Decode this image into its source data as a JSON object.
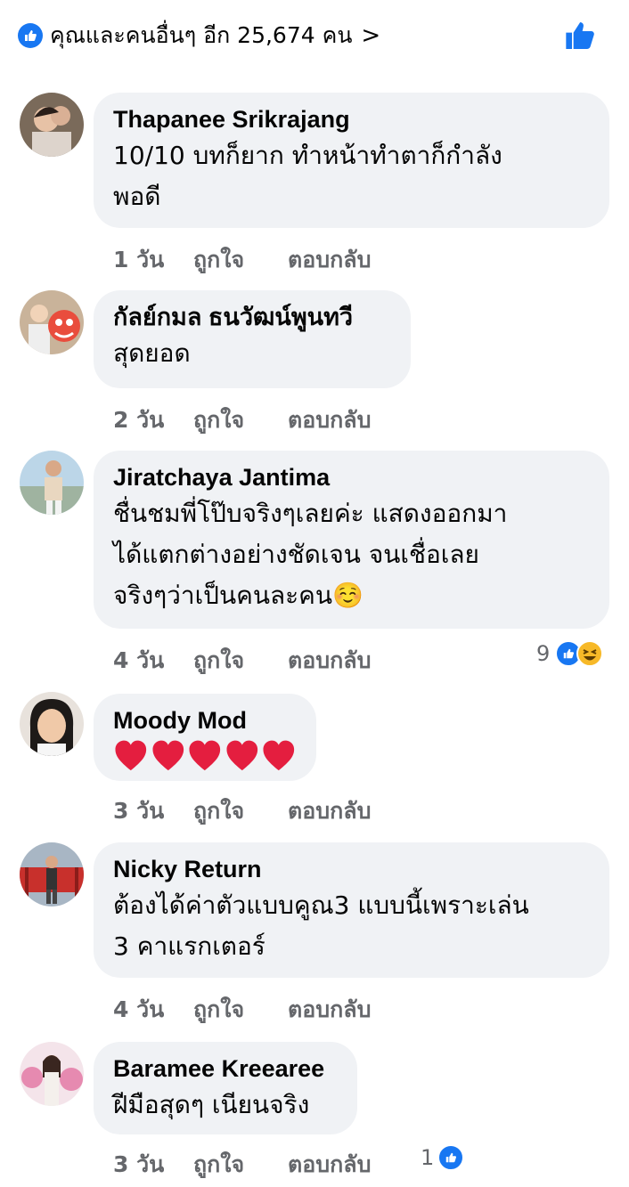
{
  "summary": {
    "text": "คุณและคนอื่นๆ อีก 25,674 คน",
    "chevron": ">"
  },
  "actions": {
    "like": "ถูกใจ",
    "reply": "ตอบกลับ"
  },
  "comments": [
    {
      "author": "Thapanee Srikrajang",
      "text_lines": [
        "10/10 บทก็ยาก ทำหน้าทำตาก็กำลัง",
        "พอดี"
      ],
      "time": "1 วัน"
    },
    {
      "author": "กัลย์กมล ธนวัฒน์พูนทวี",
      "text_lines": [
        "สุดยอด"
      ],
      "time": "2 วัน"
    },
    {
      "author": "Jiratchaya Jantima",
      "text_lines": [
        "ชื่นชมพี่โป๊บจริงๆเลยค่ะ แสดงออกมา",
        "ได้แตกต่างอย่างชัดเจน จนเชื่อเลย",
        "จริงๆว่าเป็นคนละคน☺️"
      ],
      "time": "4 วัน",
      "reactions": "9",
      "reaction_icons": [
        "like-icon",
        "haha-icon"
      ]
    },
    {
      "author": "Moody Mod",
      "text_lines": [],
      "hearts": 5,
      "time": "3 วัน"
    },
    {
      "author": "Nicky Return",
      "text_lines": [
        "ต้องได้ค่าตัวแบบคูณ3 แบบนี้เพราะเล่น",
        "3 คาแรกเตอร์"
      ],
      "time": "4 วัน"
    },
    {
      "author": "Baramee Kreearee",
      "text_lines": [
        "ฝีมือสุดๆ เนียนจริง"
      ],
      "time": "3 วัน",
      "reactions": "1",
      "reaction_icons": [
        "like-icon"
      ]
    }
  ],
  "colors": {
    "like_blue": "#1877f2",
    "bubble": "#f0f2f5",
    "meta_gray": "#65676b",
    "heart_red": "#e41e3f",
    "haha_yellow": "#f7b928"
  }
}
